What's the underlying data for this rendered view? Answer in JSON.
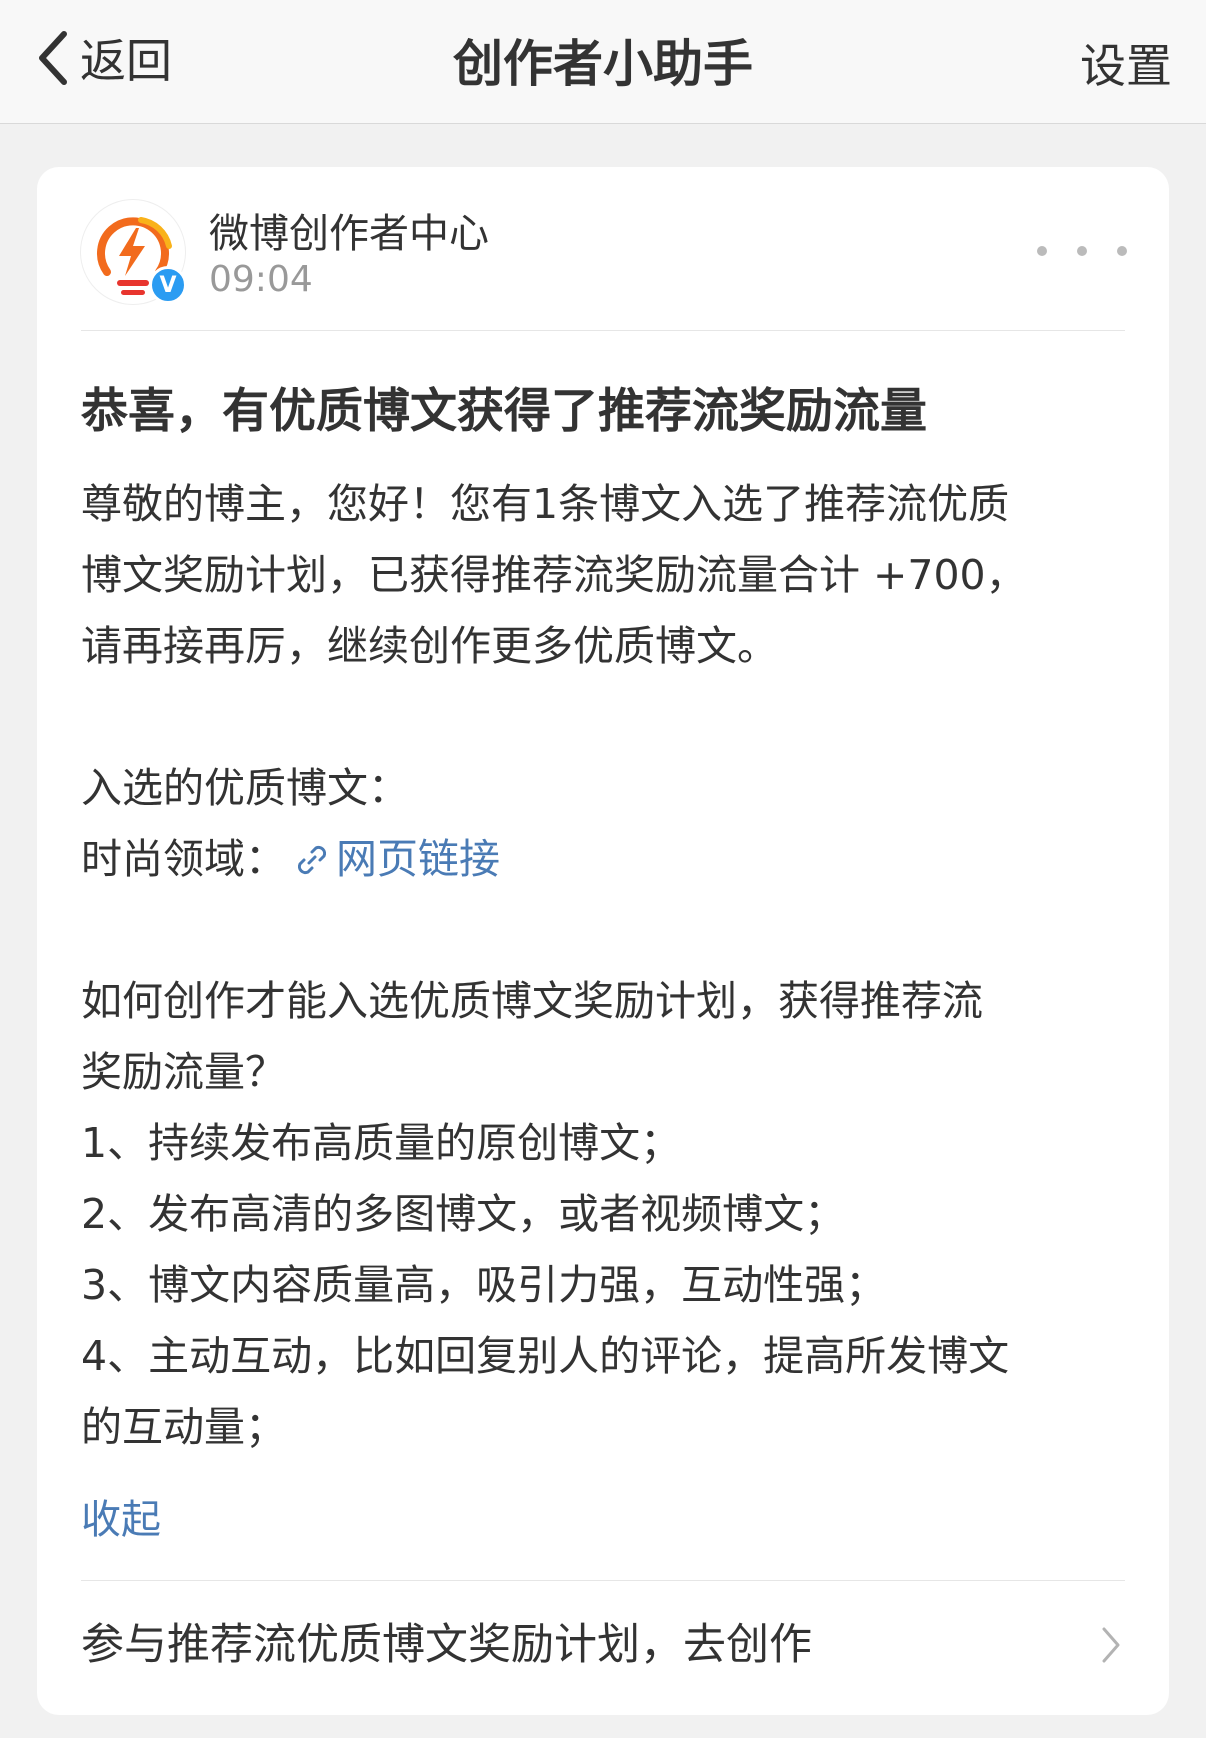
{
  "navbar": {
    "back_label": "返回",
    "title": "创作者小助手",
    "settings_label": "设置"
  },
  "message": {
    "sender_name": "微博创作者中心",
    "time": "09:04",
    "verified_mark": "V",
    "title": "恭喜，有优质博文获得了推荐流奖励流量",
    "body_lines": [
      "尊敬的博主，您好！您有1条博文入选了推荐流优质",
      "博文奖励计划，已获得推荐流奖励流量合计 +700，",
      "请再接再厉，继续创作更多优质博文。"
    ],
    "selected_heading": "入选的优质博文：",
    "category_label": "时尚领域：",
    "link_text": "网页链接",
    "tips_lines": [
      "如何创作才能入选优质博文奖励计划，获得推荐流",
      "奖励流量？",
      "1、持续发布高质量的原创博文；",
      "2、发布高清的多图博文，或者视频博文；",
      "3、博文内容质量高，吸引力强，互动性强；",
      "4、主动互动，比如回复别人的评论，提高所发博文",
      "的互动量；"
    ],
    "collapse_label": "收起",
    "footer_action": "参与推荐流优质博文奖励计划，去创作"
  },
  "colors": {
    "link": "#4a7bb5",
    "verified": "#2b9cf2",
    "logo_orange": "#f26b1d",
    "logo_yellow": "#f9b21a",
    "logo_red": "#e8352e"
  },
  "icons": [
    "chevron-left-icon",
    "lightning-bulb-logo",
    "verified-icon",
    "more-dots-icon",
    "link-icon",
    "chevron-right-icon"
  ]
}
